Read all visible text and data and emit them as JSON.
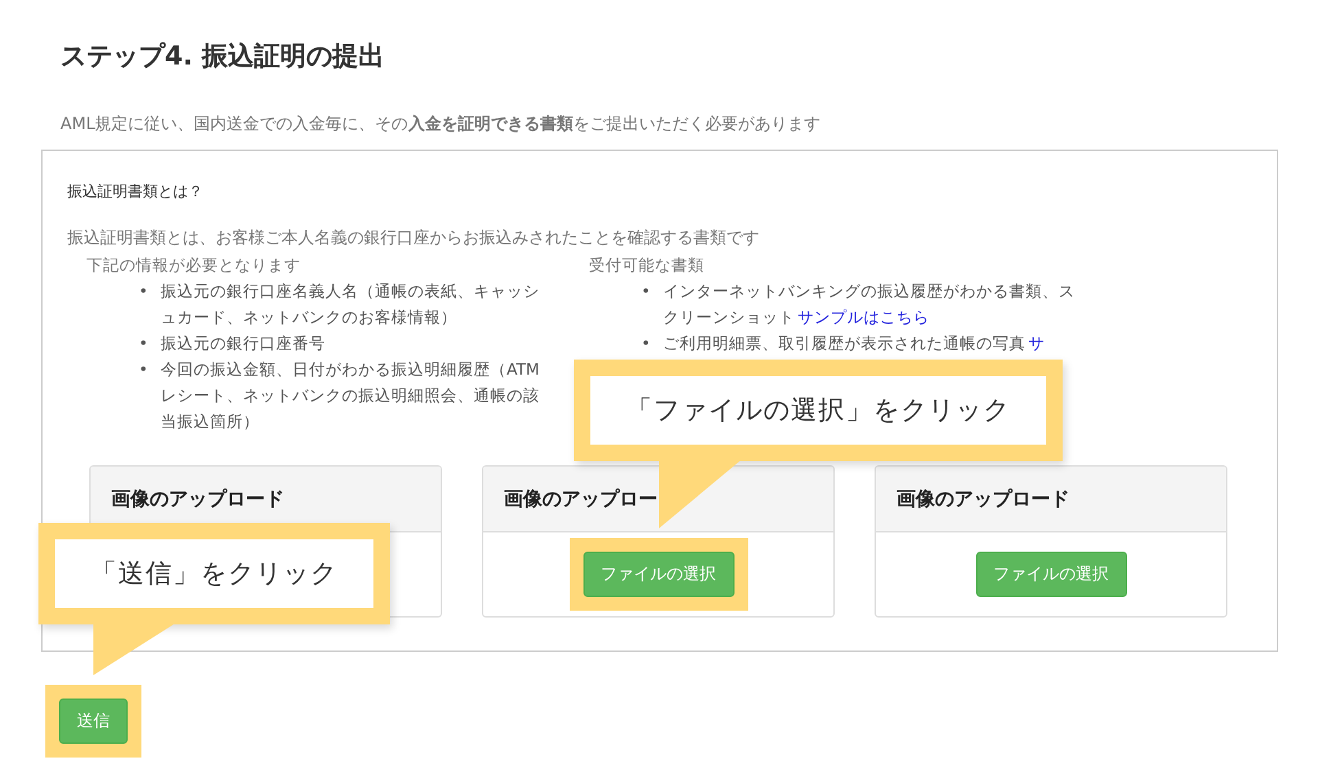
{
  "heading": "ステップ4.  振込証明の提出",
  "intro": "AML規定に従い、国内送金での入金毎に、その**入金を証明できる書類**をご提出いただく必要があります",
  "panel": {
    "question": "振込証明書類とは？",
    "description": "振込証明書類とは、お客様ご本人名義の銀行口座からお振込みされたことを確認する書類です",
    "columns": [
      {
        "heading": "下記の情報が必要となります",
        "items": [
          {
            "bullet": "•",
            "text": "振込元の銀行口座名義人名（通帳の表紙、キャッシュカード、ネットバンクのお客様情報）"
          },
          {
            "bullet": "•",
            "text": "振込元の銀行口座番号"
          },
          {
            "bullet": "•",
            "text": "今回の振込金額、日付がわかる振込明細履歴（ATMレシート、ネットバンクの振込明細照会、通帳の該当振込箇所）"
          }
        ]
      },
      {
        "heading": "受付可能な書類",
        "items": [
          {
            "bullet": "•",
            "text": "インターネットバンキングの振込履歴がわかる書類、スクリーンショット",
            "link": "サンプルはこちら"
          },
          {
            "bullet": "•",
            "text": "ご利用明細票、取引履歴が表示された通帳の写真",
            "link": "サ"
          }
        ]
      }
    ]
  },
  "cards": [
    {
      "title": "画像のアップロード"
    },
    {
      "title": "画像のアップロー",
      "button": "ファイルの選択",
      "highlighted": true
    },
    {
      "title": "画像のアップロード",
      "button": "ファイルの選択",
      "highlighted": false
    }
  ],
  "submit": {
    "label": "送信",
    "highlighted": true
  },
  "callouts": [
    {
      "text": "「ファイルの選択」をクリック",
      "kind": "file"
    },
    {
      "text": "「送信」をクリック",
      "kind": "submit"
    }
  ]
}
